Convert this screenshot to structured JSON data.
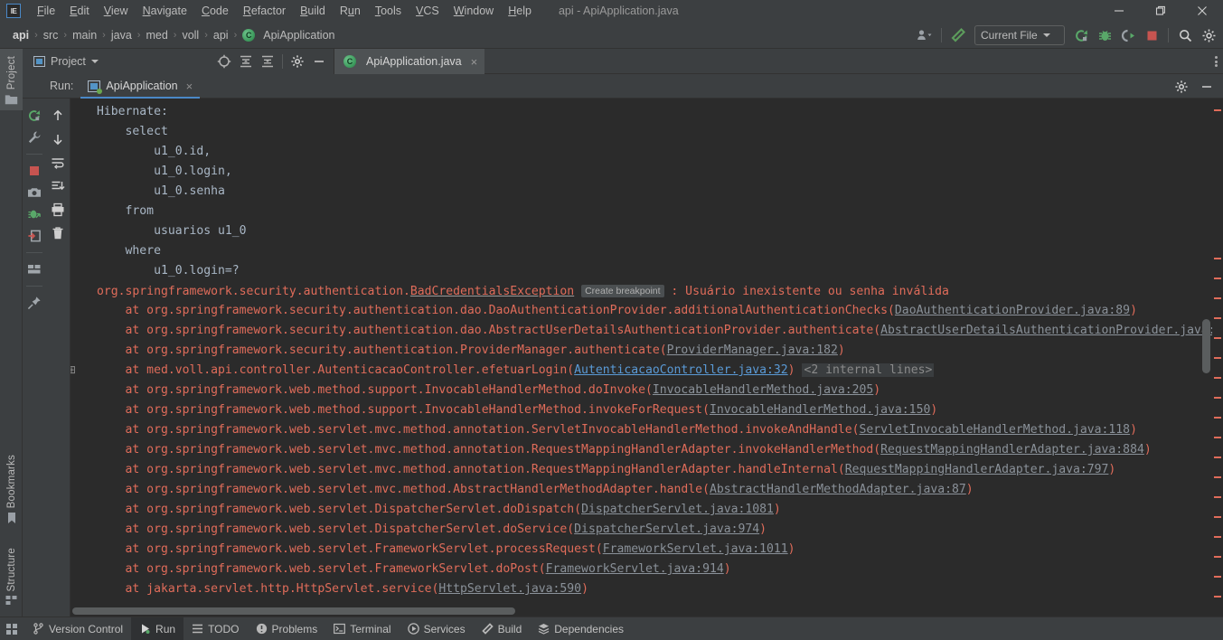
{
  "window": {
    "logo_text": "IE",
    "title": "api - ApiApplication.java",
    "minimize_label": "Minimize",
    "maximize_label": "Restore",
    "close_label": "Close"
  },
  "menubar": {
    "items": [
      {
        "label": "File",
        "mnemonic": "F"
      },
      {
        "label": "Edit",
        "mnemonic": "E"
      },
      {
        "label": "View",
        "mnemonic": "V"
      },
      {
        "label": "Navigate",
        "mnemonic": "N"
      },
      {
        "label": "Code",
        "mnemonic": "C"
      },
      {
        "label": "Refactor",
        "mnemonic": "R"
      },
      {
        "label": "Build",
        "mnemonic": "B"
      },
      {
        "label": "Run",
        "mnemonic": "u"
      },
      {
        "label": "Tools",
        "mnemonic": "T"
      },
      {
        "label": "VCS",
        "mnemonic": "V"
      },
      {
        "label": "Window",
        "mnemonic": "W"
      },
      {
        "label": "Help",
        "mnemonic": "H"
      }
    ]
  },
  "navbar": {
    "breadcrumbs": [
      "api",
      "src",
      "main",
      "java",
      "med",
      "voll",
      "api"
    ],
    "current_file": "ApiApplication",
    "current_file_icon": "class-icon",
    "run_config": "Current File",
    "icons": [
      {
        "name": "user-dropdown-icon"
      },
      {
        "name": "build-hammer-icon"
      },
      {
        "name": "run-icon"
      },
      {
        "name": "debug-icon"
      },
      {
        "name": "run-with-coverage-icon"
      },
      {
        "name": "stop-icon"
      },
      {
        "name": "search-everywhere-icon"
      },
      {
        "name": "settings-icon"
      }
    ]
  },
  "left_stripe": {
    "project_tab": "Project",
    "bookmarks_tab": "Bookmarks",
    "structure_tab": "Structure"
  },
  "project_toolbar": {
    "title": "Project",
    "buttons": [
      {
        "name": "select-opened-file-icon"
      },
      {
        "name": "expand-all-icon"
      },
      {
        "name": "collapse-all-icon"
      },
      {
        "name": "settings-icon"
      },
      {
        "name": "hide-icon"
      }
    ]
  },
  "editor_tabs": [
    {
      "label": "ApiApplication.java",
      "icon": "java-class-icon",
      "active": true,
      "close": "×"
    }
  ],
  "run_window": {
    "label": "Run:",
    "tab_name": "ApiApplication",
    "tab_close": "×",
    "header_buttons": [
      {
        "name": "settings-icon"
      },
      {
        "name": "hide-icon"
      }
    ],
    "gutter_left": [
      {
        "name": "rerun-icon"
      },
      {
        "name": "edit-configuration-wrench-icon"
      },
      {
        "name": "stop-icon"
      },
      {
        "name": "screenshot-camera-icon"
      },
      {
        "name": "attach-debugger-icon"
      },
      {
        "name": "export-icon"
      },
      {
        "name": "layout-icon"
      },
      {
        "name": "pin-icon"
      }
    ],
    "gutter_right": [
      {
        "name": "scroll-up-icon"
      },
      {
        "name": "scroll-down-icon"
      },
      {
        "name": "soft-wrap-icon"
      },
      {
        "name": "scroll-to-end-icon"
      },
      {
        "name": "print-icon"
      },
      {
        "name": "clear-all-trash-icon"
      }
    ]
  },
  "console": {
    "sql_lines": [
      "Hibernate: ",
      "    select",
      "        u1_0.id,",
      "        u1_0.login,",
      "        u1_0.senha",
      "    from",
      "        usuarios u1_0",
      "    where",
      "        u1_0.login=?"
    ],
    "exception": {
      "package_prefix": "org.springframework.security.authentication.",
      "class_name": "BadCredentialsException",
      "breakpoint_badge": "Create breakpoint",
      "separator": " : ",
      "message": "Usuário inexistente ou senha inválida"
    },
    "stack_frames": [
      {
        "text": "    at org.springframework.security.authentication.dao.DaoAuthenticationProvider.additionalAuthenticationChecks(",
        "link": "DaoAuthenticationProvider.java:89",
        "suffix": ")",
        "link_style": "grey",
        "fold": false
      },
      {
        "text": "    at org.springframework.security.authentication.dao.AbstractUserDetailsAuthenticationProvider.authenticate(",
        "link": "AbstractUserDetailsAuthenticationProvider.java:",
        "suffix": "",
        "link_style": "grey",
        "fold": false
      },
      {
        "text": "    at org.springframework.security.authentication.ProviderManager.authenticate(",
        "link": "ProviderManager.java:182",
        "suffix": ")",
        "link_style": "grey",
        "fold": false
      },
      {
        "text": "    at med.voll.api.controller.AutenticacaoController.efetuarLogin(",
        "link": "AutenticacaoController.java:32",
        "suffix": ")",
        "note": "<2 internal lines>",
        "link_style": "blue",
        "fold": true
      },
      {
        "text": "    at org.springframework.web.method.support.InvocableHandlerMethod.doInvoke(",
        "link": "InvocableHandlerMethod.java:205",
        "suffix": ")",
        "link_style": "grey",
        "fold": false
      },
      {
        "text": "    at org.springframework.web.method.support.InvocableHandlerMethod.invokeForRequest(",
        "link": "InvocableHandlerMethod.java:150",
        "suffix": ")",
        "link_style": "grey",
        "fold": false
      },
      {
        "text": "    at org.springframework.web.servlet.mvc.method.annotation.ServletInvocableHandlerMethod.invokeAndHandle(",
        "link": "ServletInvocableHandlerMethod.java:118",
        "suffix": ")",
        "link_style": "grey",
        "fold": false
      },
      {
        "text": "    at org.springframework.web.servlet.mvc.method.annotation.RequestMappingHandlerAdapter.invokeHandlerMethod(",
        "link": "RequestMappingHandlerAdapter.java:884",
        "suffix": ")",
        "link_style": "grey",
        "fold": false
      },
      {
        "text": "    at org.springframework.web.servlet.mvc.method.annotation.RequestMappingHandlerAdapter.handleInternal(",
        "link": "RequestMappingHandlerAdapter.java:797",
        "suffix": ")",
        "link_style": "grey",
        "fold": false
      },
      {
        "text": "    at org.springframework.web.servlet.mvc.method.AbstractHandlerMethodAdapter.handle(",
        "link": "AbstractHandlerMethodAdapter.java:87",
        "suffix": ")",
        "link_style": "grey",
        "fold": false
      },
      {
        "text": "    at org.springframework.web.servlet.DispatcherServlet.doDispatch(",
        "link": "DispatcherServlet.java:1081",
        "suffix": ")",
        "link_style": "grey",
        "fold": false
      },
      {
        "text": "    at org.springframework.web.servlet.DispatcherServlet.doService(",
        "link": "DispatcherServlet.java:974",
        "suffix": ")",
        "link_style": "grey",
        "fold": false
      },
      {
        "text": "    at org.springframework.web.servlet.FrameworkServlet.processRequest(",
        "link": "FrameworkServlet.java:1011",
        "suffix": ")",
        "link_style": "grey",
        "fold": false
      },
      {
        "text": "    at org.springframework.web.servlet.FrameworkServlet.doPost(",
        "link": "FrameworkServlet.java:914",
        "suffix": ")",
        "link_style": "grey",
        "fold": false
      },
      {
        "text": "    at jakarta.servlet.http.HttpServlet.service(",
        "link": "HttpServlet.java:590",
        "suffix": ")",
        "link_style": "grey",
        "fold": false
      }
    ]
  },
  "statusbar": {
    "items": [
      {
        "label": "Version Control",
        "icon": "branch-icon",
        "active": false
      },
      {
        "label": "Run",
        "icon": "run-icon",
        "active": true
      },
      {
        "label": "TODO",
        "icon": "todo-list-icon",
        "active": false
      },
      {
        "label": "Problems",
        "icon": "problems-icon",
        "active": false
      },
      {
        "label": "Terminal",
        "icon": "terminal-icon",
        "active": false
      },
      {
        "label": "Services",
        "icon": "services-icon",
        "active": false
      },
      {
        "label": "Build",
        "icon": "build-hammer-icon",
        "active": false
      },
      {
        "label": "Dependencies",
        "icon": "dependencies-icon",
        "active": false
      }
    ]
  },
  "colors": {
    "background": "#3c3f41",
    "console_bg": "#2b2b2b",
    "error_red": "#e06c5a",
    "accent_blue": "#4a88c7",
    "link_blue": "#5a9ad6",
    "text": "#bbbbbb",
    "sql_text": "#a9b7c6"
  }
}
